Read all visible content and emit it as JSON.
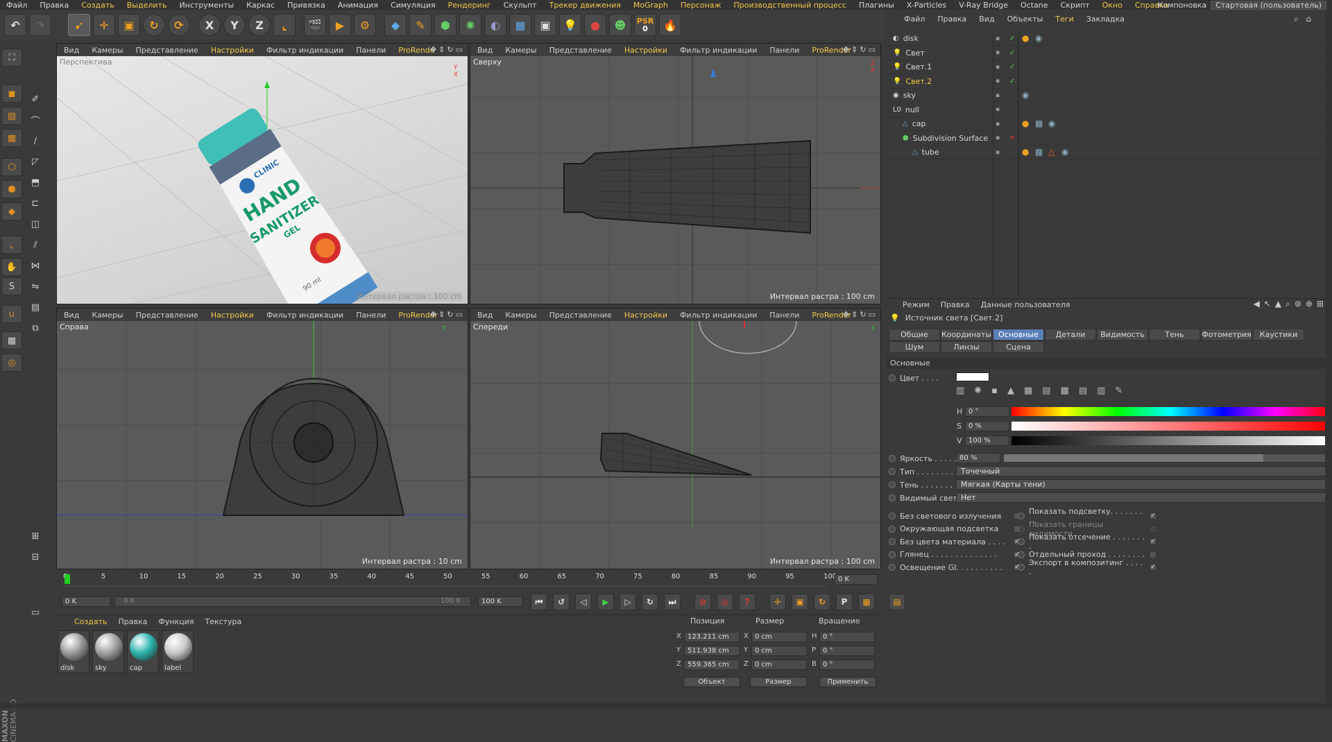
{
  "menu": {
    "items": [
      "Файл",
      "Правка",
      "Создать",
      "Выделить",
      "Инструменты",
      "Каркас",
      "Привязка",
      "Анимация",
      "Симуляция",
      "Рендеринг",
      "Скульпт",
      "Трекер движения",
      "MoGraph",
      "Персонаж",
      "Производственный процесс",
      "Плагины",
      "X-Particles",
      "V-Ray Bridge",
      "Octane",
      "Скрипт",
      "Окно",
      "Справка"
    ],
    "layout_label": "Компоновка",
    "layout_value": "Стартовая (пользователь)"
  },
  "toolbar": {
    "psr_label": "PSR",
    "psr_value": "0"
  },
  "viewports": [
    {
      "title": "Перспектива",
      "menu": [
        "Вид",
        "Камеры",
        "Представление",
        "Настройки",
        "Фильтр индикации",
        "Панели",
        "ProRende"
      ],
      "grid": "Интервал растра : 100 cm"
    },
    {
      "title": "Сверху",
      "menu": [
        "Вид",
        "Камеры",
        "Представление",
        "Настройки",
        "Фильтр индикации",
        "Панели",
        "ProRender"
      ],
      "grid": "Интервал растра : 100 cm"
    },
    {
      "title": "Справа",
      "menu": [
        "Вид",
        "Камеры",
        "Представление",
        "Настройки",
        "Фильтр индикации",
        "Панели",
        "ProRender"
      ],
      "grid": "Интервал растра : 10 cm"
    },
    {
      "title": "Спереди",
      "menu": [
        "Вид",
        "Камеры",
        "Представление",
        "Настройки",
        "Фильтр индикации",
        "Панели",
        "ProRender"
      ],
      "grid": "Интервал растра : 100 cm"
    }
  ],
  "product": {
    "brand": "CLINIC",
    "line1": "HAND",
    "line2": "SANITIZER",
    "line3": "GEL",
    "volume": "90 ml"
  },
  "object_manager": {
    "menu": [
      "Файл",
      "Правка",
      "Вид",
      "Объекты",
      "Теги",
      "Закладка"
    ],
    "objects": [
      {
        "name": "disk",
        "level": 0
      },
      {
        "name": "Свет",
        "level": 0
      },
      {
        "name": "Свет.1",
        "level": 0
      },
      {
        "name": "Свет.2",
        "level": 0
      },
      {
        "name": "sky",
        "level": 0
      },
      {
        "name": "null",
        "level": 0
      },
      {
        "name": "cap",
        "level": 1
      },
      {
        "name": "Subdivision Surface",
        "level": 1
      },
      {
        "name": "tube",
        "level": 2
      }
    ]
  },
  "attributes": {
    "menu": [
      "Режим",
      "Правка",
      "Данные пользователя"
    ],
    "title": "Источник света [Свет.2]",
    "tabs_row1": [
      "Общие",
      "Координаты",
      "Основные",
      "Детали",
      "Видимость",
      "Тень",
      "Фотометрия",
      "Каустики"
    ],
    "tabs_row2": [
      "Шум",
      "Линзы",
      "Сцена"
    ],
    "section": "Основные",
    "color_label": "Цвет . . . .",
    "h_label": "H",
    "h_value": "0 °",
    "s_label": "S",
    "s_value": "0 %",
    "v_label": "V",
    "v_value": "100 %",
    "brightness_label": "Яркость . . . . .",
    "brightness_value": "80 %",
    "brightness_level": 0.8,
    "type_label": "Тип . . . . . . . . .",
    "type_value": "Точечный",
    "shadow_label": "Тень . . . . . . . .",
    "shadow_value": "Мягкая (Карты тени)",
    "vislight_label": "Видимый свет",
    "vislight_value": "Нет",
    "left_checks": [
      "Без светового излучения",
      "Окружающая подсветка",
      "Без цвета материала . . . .",
      "Глянец . . . . . . . . . . . . . .",
      "Освещение GI. . . . . . . . . ."
    ],
    "right_checks": [
      "Показать подсветку. . . . . . . . .",
      "Показать границы видимости",
      "Показать отсечение . . . . . . . .",
      "Отдельный проход . . . . . . . .",
      "Экспорт в композитинг . . . . ."
    ]
  },
  "timeline": {
    "ticks": [
      "0",
      "5",
      "10",
      "15",
      "20",
      "25",
      "30",
      "35",
      "40",
      "45",
      "50",
      "55",
      "60",
      "65",
      "70",
      "75",
      "80",
      "85",
      "90",
      "95",
      "100"
    ],
    "frame_display": "0 K",
    "start": "0 K",
    "range_start": "0 K",
    "range_end": "100 K",
    "end": "100 K"
  },
  "materials": {
    "menu": [
      "Создать",
      "Правка",
      "Функция",
      "Текстура"
    ],
    "items": [
      {
        "name": "disk",
        "color": "#9a9a9a"
      },
      {
        "name": "sky",
        "color": "#a0a0a0"
      },
      {
        "name": "cap",
        "color": "#2bb3ad"
      },
      {
        "name": "label",
        "color": "#c8c8c8"
      }
    ]
  },
  "coords": {
    "headers": [
      "Позиция",
      "Размер",
      "Вращение"
    ],
    "x_pos": "123.211 cm",
    "y_pos": "511.938 cm",
    "z_pos": "559.365 cm",
    "x_size": "0 cm",
    "y_size": "0 cm",
    "z_size": "0 cm",
    "h": "0 °",
    "p": "0 °",
    "b": "0 °",
    "mode1": "Объект",
    "mode2": "Размер",
    "apply": "Применить"
  },
  "brand": {
    "line1": "MAXON",
    "line2": "CINEMA 4D"
  }
}
